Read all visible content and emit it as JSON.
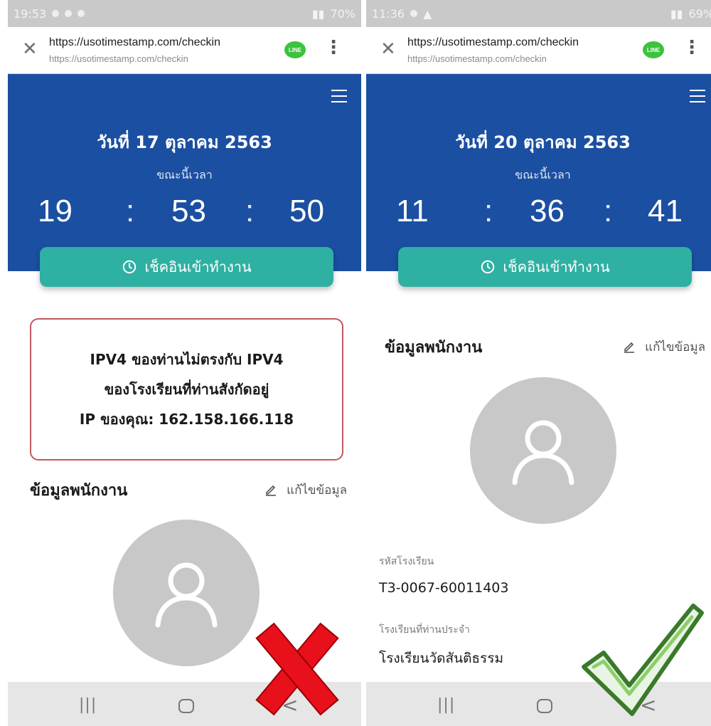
{
  "panels": [
    {
      "status": {
        "time": "19:53",
        "battery": "70%"
      },
      "browser": {
        "url": "https://usotimestamp.com/checkin",
        "subtitle": "https://usotimestamp.com/checkin",
        "app_icon": "LINE"
      },
      "header": {
        "date": "วันที่ 17 ตุลาคม 2563",
        "now_label": "ขณะนี้เวลา",
        "hour": "19",
        "minute": "53",
        "second": "50",
        "separator": ":"
      },
      "checkin_button": "เช็คอินเข้าทำงาน",
      "alert": {
        "line1": "IPV4 ของท่านไม่ตรงกับ IPV4",
        "line2": "ของโรงเรียนที่ท่านสังกัดอยู่",
        "line3": "IP ของคุณ: 162.158.166.118"
      },
      "employee": {
        "title": "ข้อมูลพนักงาน",
        "edit": "แก้ไขข้อมูล"
      },
      "nav": {
        "recents": "|||",
        "back": "<"
      },
      "result_icon": "red-x-icon"
    },
    {
      "status": {
        "time": "11:36",
        "battery": "69%"
      },
      "browser": {
        "url": "https://usotimestamp.com/checkin",
        "subtitle": "https://usotimestamp.com/checkin",
        "app_icon": "LINE"
      },
      "header": {
        "date": "วันที่ 20 ตุลาคม 2563",
        "now_label": "ขณะนี้เวลา",
        "hour": "11",
        "minute": "36",
        "second": "41",
        "separator": ":"
      },
      "checkin_button": "เช็คอินเข้าทำงาน",
      "employee": {
        "title": "ข้อมูลพนักงาน",
        "edit": "แก้ไขข้อมูล",
        "school_code_label": "รหัสโรงเรียน",
        "school_code": "T3-0067-60011403",
        "school_label": "โรงเรียนที่ท่านประจำ",
        "school": "โรงเรียนวัดสันติธรรม"
      },
      "nav": {
        "recents": "|||",
        "back": "<"
      },
      "result_icon": "green-check-icon"
    }
  ],
  "colors": {
    "header_blue": "#1b4fa1",
    "button_teal": "#2eb0a2",
    "alert_border": "#c2585e",
    "avatar_gray": "#c8c8c8"
  }
}
